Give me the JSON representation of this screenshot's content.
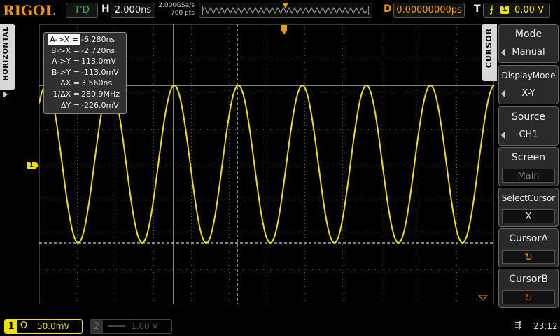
{
  "brand": "RIGOL",
  "topbar": {
    "run_status": "T'D",
    "h_label": "H",
    "timebase": "2.000ns",
    "sample_rate": "2.000GSa/s",
    "mem_depth": "700 pts",
    "d_label": "D",
    "delay": "0.00000000ps",
    "t_label": "T",
    "trigger_channel": "1",
    "trigger_level": "0.00 V"
  },
  "left_tab": "HORIZONTAL",
  "right_tab": "CURSOR",
  "measurements": [
    {
      "key": "A->X =",
      "value": "-6.280ns"
    },
    {
      "key": "B->X =",
      "value": "-2.720ns"
    },
    {
      "key": "A->Y =",
      "value": "113.0mV"
    },
    {
      "key": "B->Y =",
      "value": "-113.0mV"
    },
    {
      "key": "ΔX =",
      "value": "3.560ns"
    },
    {
      "key": "1/ΔX =",
      "value": "280.9MHz"
    },
    {
      "key": "ΔY =",
      "value": "-226.0mV"
    }
  ],
  "menu": [
    {
      "title": "Mode",
      "value": "Manual"
    },
    {
      "title": "DisplayMode",
      "value": "X-Y"
    },
    {
      "title": "Source",
      "value": "CH1"
    },
    {
      "title": "Screen",
      "value": "Main"
    },
    {
      "title": "SelectCursor",
      "value": "X"
    },
    {
      "title": "CursorA",
      "value": ""
    },
    {
      "title": "CursorB",
      "value": ""
    }
  ],
  "channels": {
    "ch1": {
      "number": "1",
      "coupling_icon": "Ω",
      "scale": "50.0mV",
      "color": "#f0e000"
    },
    "ch2": {
      "number": "2",
      "scale": "1.00 V",
      "color": "#555555"
    }
  },
  "ch1_marker": "1",
  "clock": "23:12",
  "colors": {
    "trace": "#f0e000",
    "accent": "#f39800",
    "run": "#28c828"
  }
}
